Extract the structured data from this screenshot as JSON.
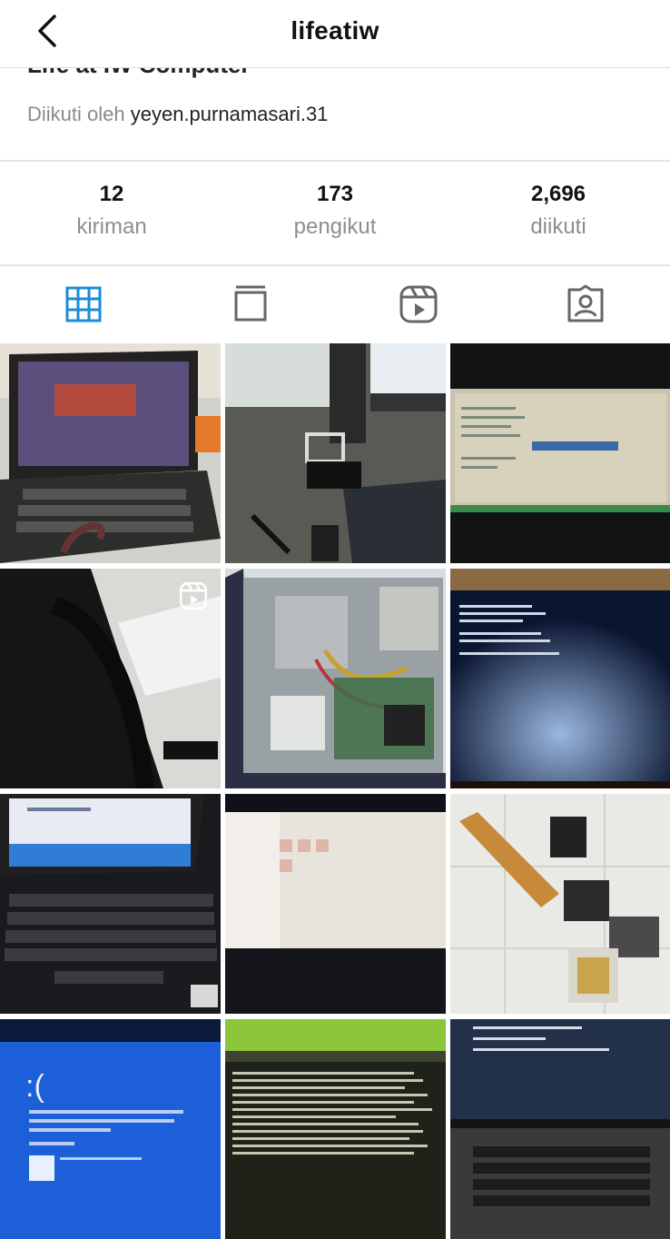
{
  "header": {
    "username": "lifeatiw"
  },
  "profile": {
    "name_partial": "Life at IW Computer",
    "followed_by_prefix": "Diikuti oleh",
    "followed_by_user": "yeyen.purnamasari.31"
  },
  "stats": [
    {
      "value": "12",
      "label": "kiriman"
    },
    {
      "value": "173",
      "label": "pengikut"
    },
    {
      "value": "2,696",
      "label": "diikuti"
    }
  ],
  "tabs": [
    {
      "icon": "grid-icon",
      "active": true
    },
    {
      "icon": "feed-icon",
      "active": false
    },
    {
      "icon": "reels-icon",
      "active": false
    },
    {
      "icon": "tagged-icon",
      "active": false
    }
  ],
  "colors": {
    "accent": "#1a8cd8",
    "icon_gray": "#666666",
    "muted_text": "#8e8e8e"
  },
  "posts": [
    {
      "desc": "Lenovo laptop booting logo"
    },
    {
      "desc": "Laptop hinge repair with clip"
    },
    {
      "desc": "BIOS setup screen"
    },
    {
      "desc": "Backpack and ASUS laptop",
      "reel": true
    },
    {
      "desc": "Open desktop PC case"
    },
    {
      "desc": "Boot error on dark screen"
    },
    {
      "desc": "Laptop Windows setup screen"
    },
    {
      "desc": "Washed-out laptop display"
    },
    {
      "desc": "Spare parts and HDD caddy"
    },
    {
      "desc": "Blue screen error"
    },
    {
      "desc": "Terminal log on screen"
    },
    {
      "desc": "HP system diagnostics screen"
    }
  ]
}
